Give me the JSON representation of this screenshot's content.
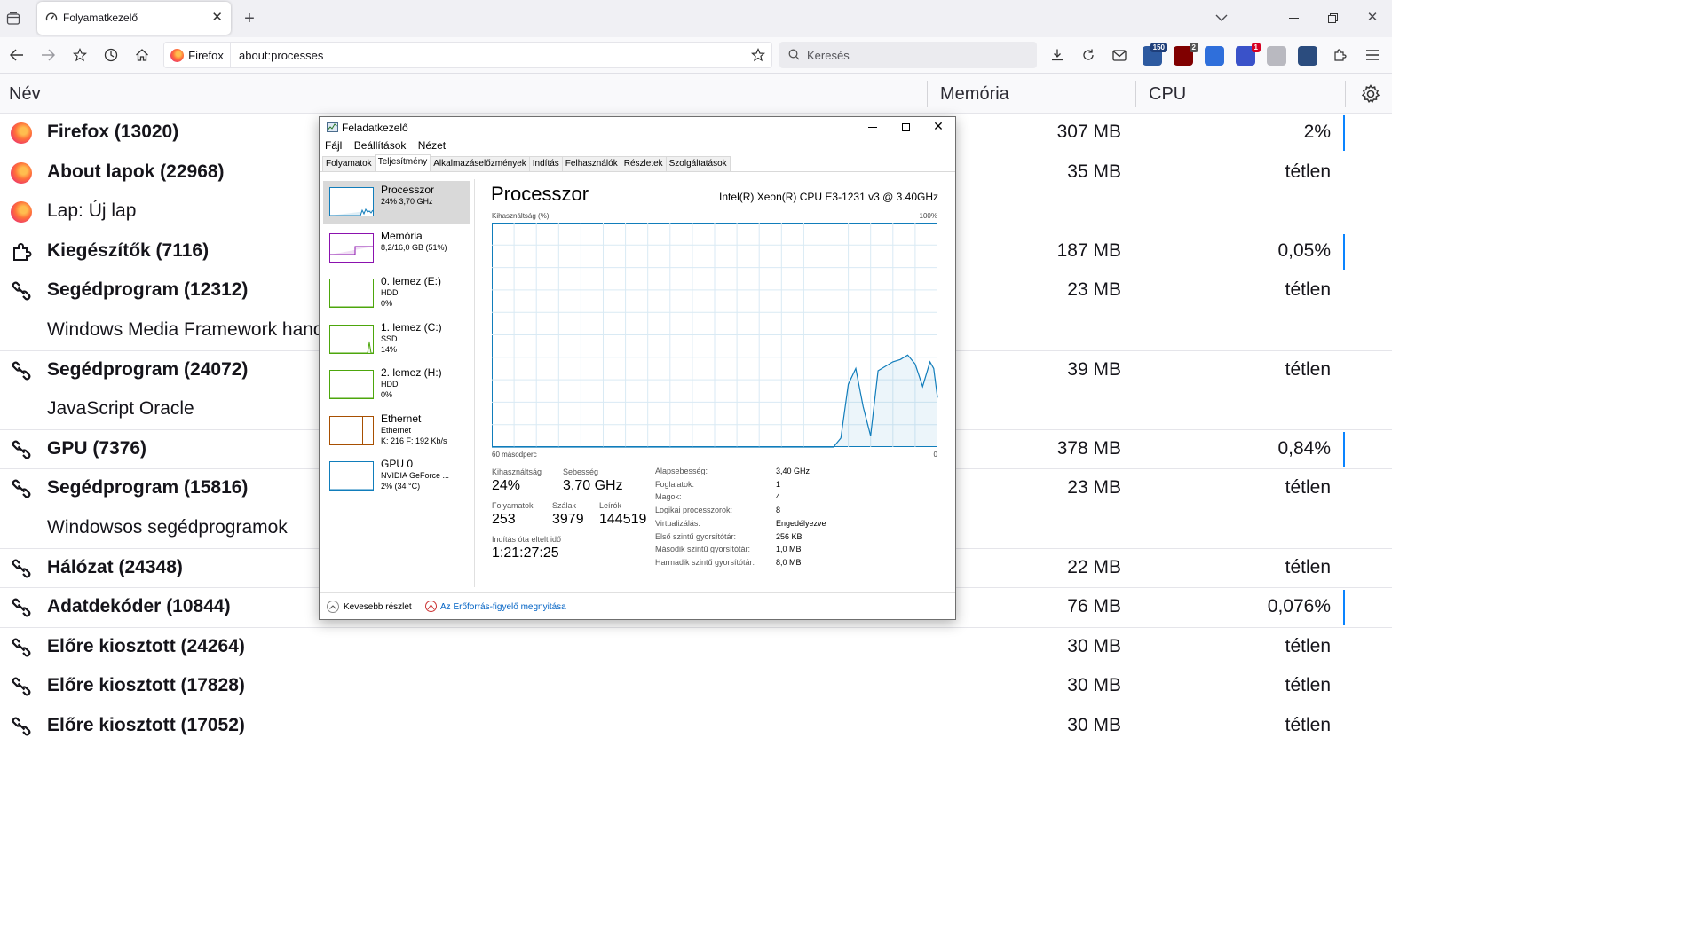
{
  "browser": {
    "tab_title": "Folyamatkezelő",
    "identity_label": "Firefox",
    "url": "about:processes",
    "search_placeholder": "Keresés",
    "extensions": [
      {
        "name": "extension-a-icon",
        "badge": "150",
        "color": "#2d5aa0",
        "badge_color": "#1f3f7a"
      },
      {
        "name": "ublock-icon",
        "badge": "2",
        "color": "#800000",
        "badge_color": "#555555"
      },
      {
        "name": "translate-icon",
        "badge": "",
        "color": "#2f6fdb",
        "badge_color": ""
      },
      {
        "name": "extension-d-icon",
        "badge": "1",
        "color": "#3a52c9",
        "badge_color": "#d70022"
      },
      {
        "name": "extension-e-icon",
        "badge": "",
        "color": "#b9b9c0",
        "badge_color": ""
      },
      {
        "name": "extension-f-icon",
        "badge": "",
        "color": "#2b4c7e",
        "badge_color": ""
      }
    ]
  },
  "table": {
    "col_name": "Név",
    "col_memory": "Memória",
    "col_cpu": "CPU",
    "rows": [
      {
        "icon": "firefox",
        "name": "Firefox (13020)",
        "bold": true,
        "memory": "307 MB",
        "cpu": "2%",
        "bar": true
      },
      {
        "icon": "firefox",
        "name": "About lapok (22968)",
        "bold": true,
        "memory": "35 MB",
        "cpu": "tétlen",
        "bar": false
      },
      {
        "icon": "firefox",
        "name": "Lap: Új lap",
        "bold": false,
        "memory": "",
        "cpu": "",
        "bar": false,
        "divider": true
      },
      {
        "icon": "puzzle",
        "name": "Kiegészítők (7116)",
        "bold": true,
        "memory": "187 MB",
        "cpu": "0,05%",
        "bar": true,
        "divider": true
      },
      {
        "icon": "link",
        "name": "Segédprogram (12312)",
        "bold": true,
        "memory": "23 MB",
        "cpu": "tétlen",
        "bar": false
      },
      {
        "icon": "none",
        "name": "Windows Media Framework handler",
        "bold": false,
        "memory": "",
        "cpu": "",
        "bar": false,
        "divider": true
      },
      {
        "icon": "link",
        "name": "Segédprogram (24072)",
        "bold": true,
        "memory": "39 MB",
        "cpu": "tétlen",
        "bar": false
      },
      {
        "icon": "none",
        "name": "JavaScript Oracle",
        "bold": false,
        "memory": "",
        "cpu": "",
        "bar": false,
        "divider": true
      },
      {
        "icon": "link",
        "name": "GPU (7376)",
        "bold": true,
        "memory": "378 MB",
        "cpu": "0,84%",
        "bar": true,
        "divider": true
      },
      {
        "icon": "link",
        "name": "Segédprogram (15816)",
        "bold": true,
        "memory": "23 MB",
        "cpu": "tétlen",
        "bar": false
      },
      {
        "icon": "none",
        "name": "Windowsos segédprogramok",
        "bold": false,
        "memory": "",
        "cpu": "",
        "bar": false,
        "divider": true
      },
      {
        "icon": "link",
        "name": "Hálózat (24348)",
        "bold": true,
        "memory": "22 MB",
        "cpu": "tétlen",
        "bar": false,
        "divider": true
      },
      {
        "icon": "link",
        "name": "Adatdekóder (10844)",
        "bold": true,
        "memory": "76 MB",
        "cpu": "0,076%",
        "bar": true,
        "divider": true
      },
      {
        "icon": "link",
        "name": "Előre kiosztott (24264)",
        "bold": true,
        "memory": "30 MB",
        "cpu": "tétlen",
        "bar": false
      },
      {
        "icon": "link",
        "name": "Előre kiosztott (17828)",
        "bold": true,
        "memory": "30 MB",
        "cpu": "tétlen",
        "bar": false
      },
      {
        "icon": "link",
        "name": "Előre kiosztott (17052)",
        "bold": true,
        "memory": "30 MB",
        "cpu": "tétlen",
        "bar": false
      }
    ]
  },
  "taskmgr": {
    "title": "Feladatkezelő",
    "menu": [
      "Fájl",
      "Beállítások",
      "Nézet"
    ],
    "tabs": [
      "Folyamatok",
      "Teljesítmény",
      "Alkalmazáselőzmények",
      "Indítás",
      "Felhasználók",
      "Részletek",
      "Szolgáltatások"
    ],
    "active_tab": 1,
    "sidebar": [
      {
        "title": "Processzor",
        "line2": "24% 3,70 GHz",
        "line3": "",
        "color": "#117dbb",
        "selected": true
      },
      {
        "title": "Memória",
        "line2": "8,2/16,0 GB (51%)",
        "line3": "",
        "color": "#8b12ae",
        "selected": false
      },
      {
        "title": "0. lemez (E:)",
        "line2": "HDD",
        "line3": "0%",
        "color": "#4da60c",
        "selected": false
      },
      {
        "title": "1. lemez (C:)",
        "line2": "SSD",
        "line3": "14%",
        "color": "#4da60c",
        "selected": false
      },
      {
        "title": "2. lemez (H:)",
        "line2": "HDD",
        "line3": "0%",
        "color": "#4da60c",
        "selected": false
      },
      {
        "title": "Ethernet",
        "line2": "Ethernet",
        "line3": "K: 216  F:  192 Kb/s",
        "color": "#a74f01",
        "selected": false
      },
      {
        "title": "GPU 0",
        "line2": "NVIDIA GeForce ...",
        "line3": "2% (34 °C)",
        "color": "#117dbb",
        "selected": false
      }
    ],
    "panel_title": "Processzor",
    "cpu_name": "Intel(R) Xeon(R) CPU E3-1231 v3 @ 3.40GHz",
    "axis_label": "Kihasználtság (%)",
    "axis_max": "100%",
    "axis_left": "60 másodperc",
    "axis_right": "0",
    "stats": {
      "util_label": "Kihasználtság",
      "util_value": "24%",
      "speed_label": "Sebesség",
      "speed_value": "3,70 GHz",
      "proc_label": "Folyamatok",
      "proc_value": "253",
      "threads_label": "Szálak",
      "threads_value": "3979",
      "handles_label": "Leírók",
      "handles_value": "144519",
      "uptime_label": "Indítás óta eltelt idő",
      "uptime_value": "1:21:27:25"
    },
    "specs": [
      {
        "label": "Alapsebesség:",
        "value": "3,40 GHz"
      },
      {
        "label": "Foglalatok:",
        "value": "1"
      },
      {
        "label": "Magok:",
        "value": "4"
      },
      {
        "label": "Logikai processzorok:",
        "value": "8"
      },
      {
        "label": "Virtualizálás:",
        "value": "Engedélyezve"
      },
      {
        "label": "Első szintű gyorsítótár:",
        "value": "256 KB"
      },
      {
        "label": "Második szintű gyorsítótár:",
        "value": "1,0 MB"
      },
      {
        "label": "Harmadik szintű gyorsítótár:",
        "value": "8,0 MB"
      }
    ],
    "footer_less": "Kevesebb részlet",
    "footer_link": "Az Erőforrás-figyelő megnyitása",
    "cpu_history": [
      {
        "t": 60,
        "v": 0
      },
      {
        "t": 56,
        "v": 0
      },
      {
        "t": 52,
        "v": 0
      },
      {
        "t": 48,
        "v": 0
      },
      {
        "t": 44,
        "v": 0
      },
      {
        "t": 40,
        "v": 0
      },
      {
        "t": 36,
        "v": 0
      },
      {
        "t": 32,
        "v": 0
      },
      {
        "t": 28,
        "v": 0
      },
      {
        "t": 24,
        "v": 0
      },
      {
        "t": 20,
        "v": 0
      },
      {
        "t": 14,
        "v": 0
      },
      {
        "t": 13,
        "v": 4
      },
      {
        "t": 12,
        "v": 28
      },
      {
        "t": 11,
        "v": 35
      },
      {
        "t": 10,
        "v": 18
      },
      {
        "t": 9,
        "v": 5
      },
      {
        "t": 8,
        "v": 34
      },
      {
        "t": 6,
        "v": 38
      },
      {
        "t": 5,
        "v": 39
      },
      {
        "t": 4,
        "v": 41
      },
      {
        "t": 3,
        "v": 37
      },
      {
        "t": 2,
        "v": 27
      },
      {
        "t": 1,
        "v": 38
      },
      {
        "t": 0.5,
        "v": 35
      },
      {
        "t": 0,
        "v": 22
      }
    ]
  }
}
